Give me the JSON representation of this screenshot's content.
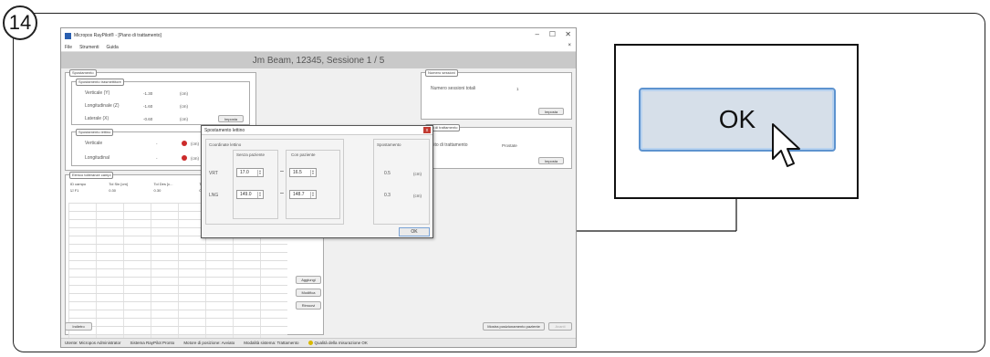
{
  "step": {
    "number": "14"
  },
  "window": {
    "title": "Micropos RayPilot® - [Piano di trattamento]",
    "controls": {
      "minimize": "–",
      "maximize": "☐",
      "close": "✕"
    },
    "menu": [
      "File",
      "Strumenti",
      "Guida"
    ],
    "menu_close": "×",
    "header": "Jm Beam, 12345, Sessione 1 / 5"
  },
  "spostamento": {
    "title": "Spostamento",
    "isocentro": {
      "title": "Spostamento trasmettitore",
      "rows": [
        {
          "label": "Verticale (Y)",
          "value": "-1.30",
          "unit": "(cm)"
        },
        {
          "label": "Longitudinale (Z)",
          "value": "-1.60",
          "unit": "(cm)"
        },
        {
          "label": "Laterale (X)",
          "value": "-0.60",
          "unit": "(cm)"
        }
      ],
      "button": "Imposta"
    },
    "lettino": {
      "title": "Spostamento lettino",
      "rows": [
        {
          "label": "Verticale",
          "value": "-",
          "unit": "(cm)"
        },
        {
          "label": "Longitudinal",
          "value": "-",
          "unit": "(cm)"
        }
      ]
    }
  },
  "numero_sessioni": {
    "title": "Numero sessioni",
    "label": "Numero sessioni totali",
    "value": "1",
    "button": "Imposta"
  },
  "sito": {
    "title": "Sito di trattamento",
    "label": "Sito di trattamento",
    "value": "Prostate",
    "button": "Imposta"
  },
  "campi": {
    "title": "Elenco tolleranze campi",
    "headers": [
      "ID campo",
      "Tol Sin [cm]",
      "Tol Des [c...",
      "Tol Sup [cm]",
      "Tol Inf [cm]"
    ],
    "rows": [
      {
        "id": "F1",
        "values": [
          "0.30",
          "0.30",
          "0.30",
          "0.30"
        ]
      }
    ],
    "buttons": {
      "add": "Aggiungi",
      "edit": "Modifica",
      "remove": "Rimuovi"
    }
  },
  "footer": {
    "back": "Indietro",
    "show_position": "Mostra posizionamento paziente",
    "next": "Avanti"
  },
  "statusbar": {
    "user": "Utente: Micropos Administrator",
    "system": "Sistema RayPilot Pronto",
    "motor": "Motore di posizione: Avviato",
    "mode": "Modalità sistema: Trattamento",
    "quality": "Qualità della misurazione OK"
  },
  "dialog": {
    "title": "Spostamento lettino",
    "coord_label": "Coordinate lettino",
    "col_without": "Senza paziente",
    "col_with": "Con paziente",
    "col_shift": "Spostamento",
    "rows": [
      {
        "label": "VRT",
        "without": "17.0",
        "with": "16.5",
        "shift": "0.5",
        "unit": "(cm)"
      },
      {
        "label": "LNG",
        "without": "149.0",
        "with": "148.7",
        "shift": "0.3",
        "unit": "(cm)"
      }
    ],
    "dash": "–",
    "ok": "OK",
    "close": "x"
  },
  "zoom": {
    "ok": "OK"
  },
  "colors": {
    "accent": "#5d93cf",
    "warn": "#cc2b2b",
    "status_ok": "#d8b800"
  }
}
